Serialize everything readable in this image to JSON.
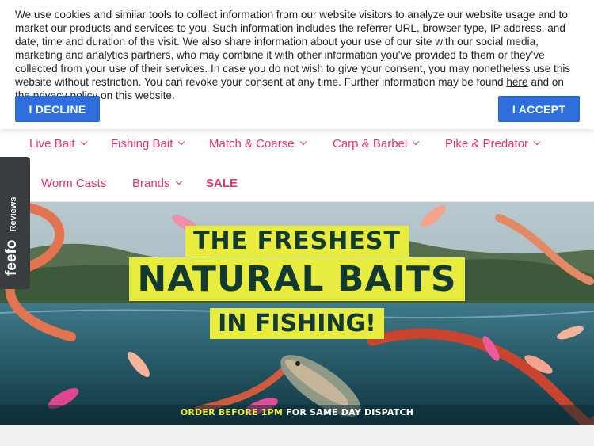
{
  "cookie": {
    "text_before_link": "We use cookies and similar tools to collect information from our website visitors to analyze our website usage and to market our products and services to you. Such information includes the referrer URL, browser type, IP address, and date, time and duration of the visit. We also share information about your use of our site with our social media, marketing and analytics partners, who may combine it with other information you’ve provided to them or they’ve collected from your use of their services. In case you do not wish to give your consent, you may nonetheless use this website without restriction. You can revoke your consent at any time. Further information may be found ",
    "link_text": "here",
    "text_after_link": " and on the privacy policy on this website.",
    "decline_label": "I DECLINE",
    "accept_label": "I ACCEPT"
  },
  "nav": {
    "row1": [
      {
        "label": "Live Bait"
      },
      {
        "label": "Fishing Bait"
      },
      {
        "label": "Match & Coarse"
      },
      {
        "label": "Carp & Barbel"
      },
      {
        "label": "Pike & Predator"
      }
    ],
    "row2": [
      {
        "label": "Worm Casts"
      },
      {
        "label": "Brands"
      },
      {
        "label": "SALE"
      }
    ]
  },
  "hero": {
    "line1": "THE FRESHEST",
    "line2": "NATURAL BAITS",
    "line3": "IN FISHING!",
    "dispatch_highlight": "ORDER BEFORE 1PM",
    "dispatch_rest": " FOR SAME DAY DISPATCH"
  },
  "feefo": {
    "logo": "feefo",
    "label": "Reviews"
  },
  "colors": {
    "accent_pink": "#e0356e",
    "button_blue": "#2f6fdc",
    "hero_yellow": "#e7ec3f",
    "feefo_bg": "#3a3d40"
  }
}
